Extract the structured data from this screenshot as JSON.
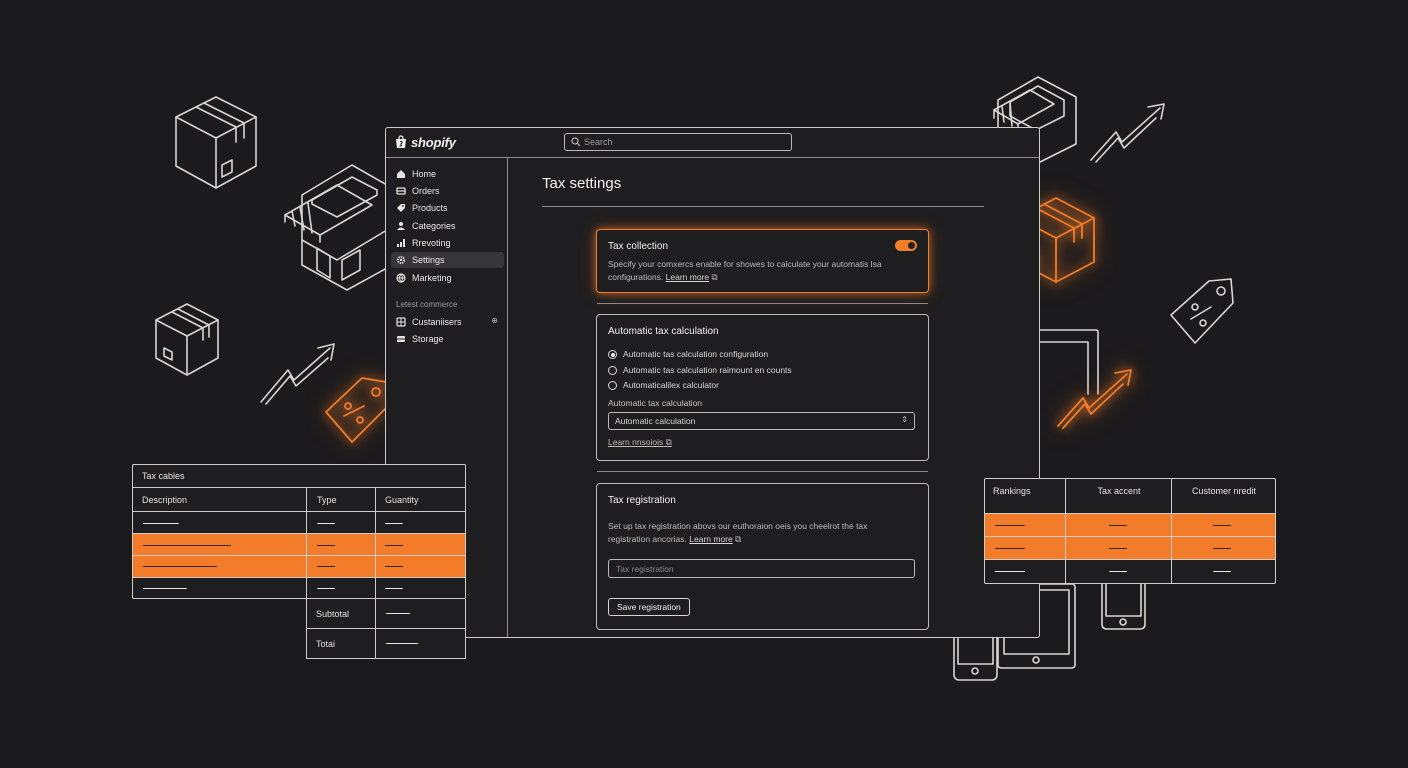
{
  "app": {
    "brand": "shopify"
  },
  "search": {
    "placeholder": "Search"
  },
  "sidebar": {
    "items": [
      {
        "label": "Home",
        "icon": "home-icon"
      },
      {
        "label": "Orders",
        "icon": "orders-icon"
      },
      {
        "label": "Products",
        "icon": "tag-icon"
      },
      {
        "label": "Categories",
        "icon": "user-icon"
      },
      {
        "label": "Rrevoting",
        "icon": "bar-chart-icon"
      },
      {
        "label": "Settings",
        "icon": "gear-icon",
        "active": true
      },
      {
        "label": "Marketing",
        "icon": "globe-icon"
      }
    ],
    "section_title": "Letest commerce",
    "section_items": [
      {
        "label": "Custaniisers",
        "icon": "grid-icon",
        "extra": "⊕"
      },
      {
        "label": "Storage",
        "icon": "storage-icon"
      }
    ]
  },
  "page": {
    "title": "Tax settings"
  },
  "tax_collection": {
    "title": "Tax collection",
    "enabled": true,
    "description": "Specify your comxercs enable for showes to calculate your automatis lsa configurations.",
    "link": "Learn more"
  },
  "auto_tax": {
    "title": "Automatic tax calculation",
    "options": [
      {
        "label": "Automatic tas calculation configuration",
        "selected": true
      },
      {
        "label": "Automatic tas calculation raimount en counts",
        "selected": false
      },
      {
        "label": "Automaticalilex calculator",
        "selected": false
      }
    ],
    "select_label": "Automatic tax calculation",
    "select_value": "Automatic calculation",
    "link": "Learn nnsoiois"
  },
  "tax_registration": {
    "title": "Tax registration",
    "description": "Set up tax registration abovs our euthoraion oeis you cheelrot the tax registration ancorias.",
    "link": "Learn more",
    "input_placeholder": "Tax registration",
    "button": "Save registration"
  },
  "tax_table": {
    "title": "Tax cables",
    "columns": [
      "Description",
      "Type",
      "Guantity"
    ],
    "rows": 4,
    "highlighted_rows": [
      2,
      3
    ],
    "subtotal_label": "Subtotal",
    "total_label": "Totai"
  },
  "rank_table": {
    "columns": [
      "Rankings",
      "Tax accent",
      "Customer nredit"
    ],
    "rows": 3,
    "highlighted_rows": [
      1,
      2
    ]
  },
  "colors": {
    "accent": "#f27c2a",
    "background": "#1b1a1c",
    "line": "#d9d6d2"
  }
}
